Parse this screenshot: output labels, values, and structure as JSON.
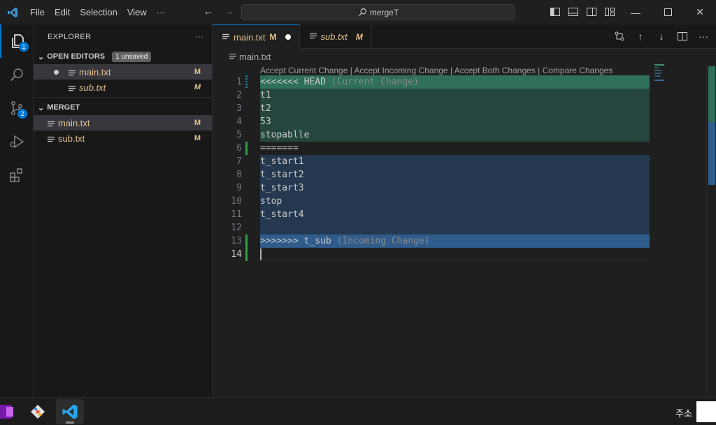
{
  "titlebar": {
    "menu": [
      "File",
      "Edit",
      "Selection",
      "View",
      "···"
    ],
    "search_text": "mergeT"
  },
  "activity": {
    "explorer_badge": "1",
    "scm_badge": "2"
  },
  "sidebar": {
    "title": "EXPLORER",
    "more": "···",
    "open_editors_label": "OPEN EDITORS",
    "unsaved_badge": "1 unsaved",
    "open_editors": [
      {
        "name": "main.txt",
        "status": "M"
      },
      {
        "name": "sub.txt",
        "status": "M"
      }
    ],
    "folder_label": "MERGET",
    "files": [
      {
        "name": "main.txt",
        "status": "M"
      },
      {
        "name": "sub.txt",
        "status": "M"
      }
    ]
  },
  "tabs": [
    {
      "name": "main.txt",
      "status": "M"
    },
    {
      "name": "sub.txt",
      "status": "M"
    }
  ],
  "breadcrumb": "main.txt",
  "codelens": "Accept Current Change | Accept Incoming Change | Accept Both Changes | Compare Changes",
  "lines": [
    {
      "n": "1",
      "text": "<<<<<<< HEAD",
      "hint": " (Current Change)"
    },
    {
      "n": "2",
      "text": "t1"
    },
    {
      "n": "3",
      "text": "t2"
    },
    {
      "n": "4",
      "text": "53"
    },
    {
      "n": "5",
      "text": "stopablle"
    },
    {
      "n": "6",
      "text": "======="
    },
    {
      "n": "7",
      "text": "t_start1"
    },
    {
      "n": "8",
      "text": "t_start2"
    },
    {
      "n": "9",
      "text": "t_start3"
    },
    {
      "n": "10",
      "text": "stop"
    },
    {
      "n": "11",
      "text": "t_start4"
    },
    {
      "n": "12",
      "text": ""
    },
    {
      "n": "13",
      "text": ">>>>>>> t_sub",
      "hint": " (Incoming Change)"
    },
    {
      "n": "14",
      "text": ""
    }
  ],
  "taskbar": {
    "address_label": "주소"
  },
  "colors": {
    "accent": "#0078d4",
    "modified": "#e2c08d",
    "current_change": "#2f6f5c",
    "incoming_change": "#2f5c8a"
  }
}
